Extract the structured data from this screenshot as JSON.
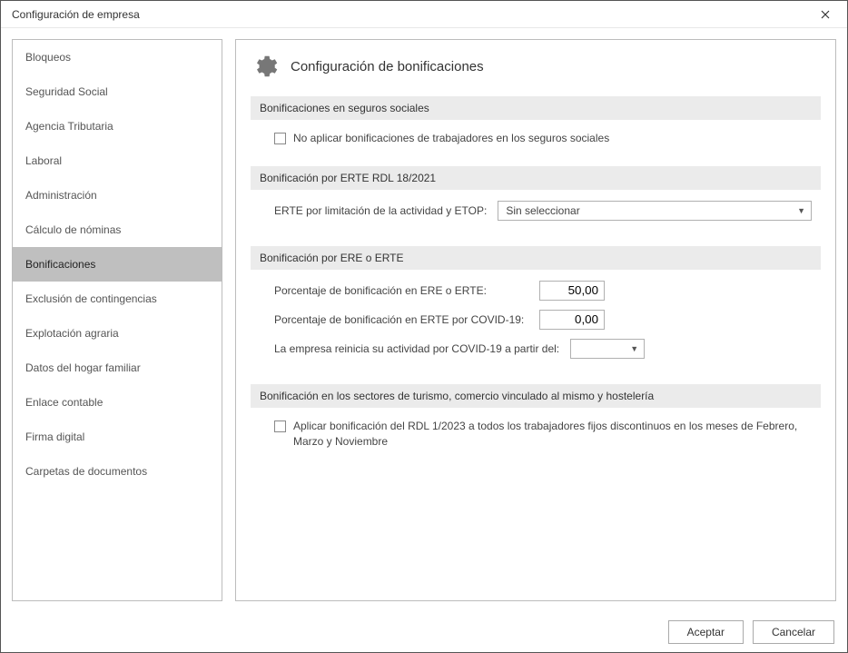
{
  "window": {
    "title": "Configuración de empresa"
  },
  "sidebar": {
    "items": [
      {
        "label": "Bloqueos"
      },
      {
        "label": "Seguridad Social"
      },
      {
        "label": "Agencia Tributaria"
      },
      {
        "label": "Laboral"
      },
      {
        "label": "Administración"
      },
      {
        "label": "Cálculo de nóminas"
      },
      {
        "label": "Bonificaciones"
      },
      {
        "label": "Exclusión de contingencias"
      },
      {
        "label": "Explotación agraria"
      },
      {
        "label": "Datos del hogar familiar"
      },
      {
        "label": "Enlace contable"
      },
      {
        "label": "Firma digital"
      },
      {
        "label": "Carpetas de documentos"
      }
    ],
    "selected_index": 6
  },
  "page": {
    "title": "Configuración de bonificaciones"
  },
  "sections": {
    "seguros": {
      "header": "Bonificaciones en seguros sociales",
      "no_aplicar_label": "No aplicar bonificaciones de trabajadores en los seguros sociales",
      "no_aplicar_checked": false
    },
    "erte_rdl": {
      "header": "Bonificación por ERTE RDL 18/2021",
      "field_label": "ERTE por limitación de la actividad y ETOP:",
      "select_value": "Sin seleccionar"
    },
    "ere_erte": {
      "header": "Bonificación por ERE o ERTE",
      "pct_ere_label": "Porcentaje de bonificación en ERE o ERTE:",
      "pct_ere_value": "50,00",
      "pct_covid_label": "Porcentaje de bonificación en ERTE por COVID-19:",
      "pct_covid_value": "0,00",
      "reinicia_label": "La empresa reinicia su actividad por COVID-19 a partir del:",
      "reinicia_value": ""
    },
    "turismo": {
      "header": "Bonificación en los sectores de turismo, comercio vinculado al mismo y hostelería",
      "aplicar_rdl_label": "Aplicar bonificación del RDL 1/2023 a todos los trabajadores fijos discontinuos en los meses de Febrero, Marzo y Noviembre",
      "aplicar_rdl_checked": false
    }
  },
  "footer": {
    "accept": "Aceptar",
    "cancel": "Cancelar"
  }
}
